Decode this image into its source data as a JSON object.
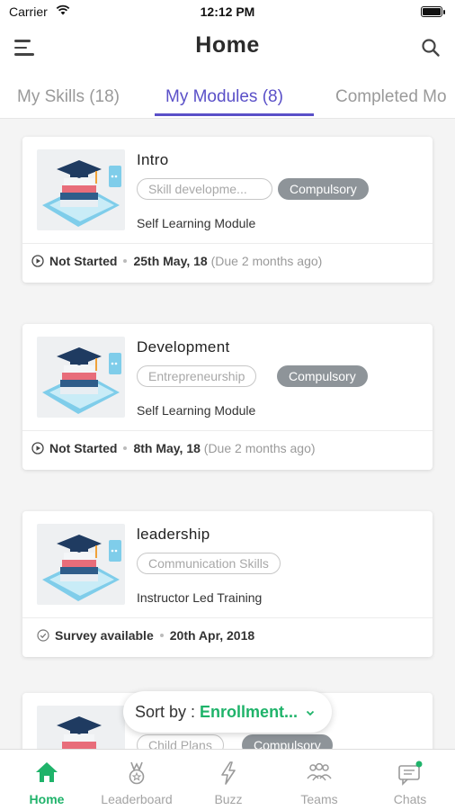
{
  "status_bar": {
    "carrier": "Carrier",
    "time": "12:12 PM"
  },
  "header": {
    "title": "Home"
  },
  "tabs": [
    {
      "label": "My Skills (18)"
    },
    {
      "label": "My Modules (8)"
    },
    {
      "label": "Completed Mo"
    }
  ],
  "active_tab": "My Modules (8)",
  "cards": [
    {
      "title": "Intro",
      "skill_chip": "Skill developme...",
      "badge": "Compulsory",
      "type": "Self Learning Module",
      "status": "Not Started",
      "date": "25th May, 18",
      "due": "(Due 2 months ago)"
    },
    {
      "title": "Development",
      "skill_chip": "Entrepreneurship",
      "badge": "Compulsory",
      "type": "Self Learning Module",
      "status": "Not Started",
      "date": "8th May, 18",
      "due": "(Due 2 months ago)"
    },
    {
      "title": "leadership",
      "skill_chip": "Communication Skills",
      "type": "Instructor Led Training",
      "status": "Survey available",
      "date": "20th Apr, 2018"
    },
    {
      "skill_chip": "Child Plans",
      "badge": "Compulsory"
    }
  ],
  "sort": {
    "label": "Sort by :",
    "value": "Enrollment..."
  },
  "bottom_nav": [
    {
      "label": "Home",
      "icon": "home-icon"
    },
    {
      "label": "Leaderboard",
      "icon": "medal-icon"
    },
    {
      "label": "Buzz",
      "icon": "lightning-icon"
    },
    {
      "label": "Teams",
      "icon": "team-icon"
    },
    {
      "label": "Chats",
      "icon": "chat-icon"
    }
  ],
  "colors": {
    "accent": "#5a50c8",
    "green": "#1fb36a",
    "chip_filled": "#8e9499"
  }
}
